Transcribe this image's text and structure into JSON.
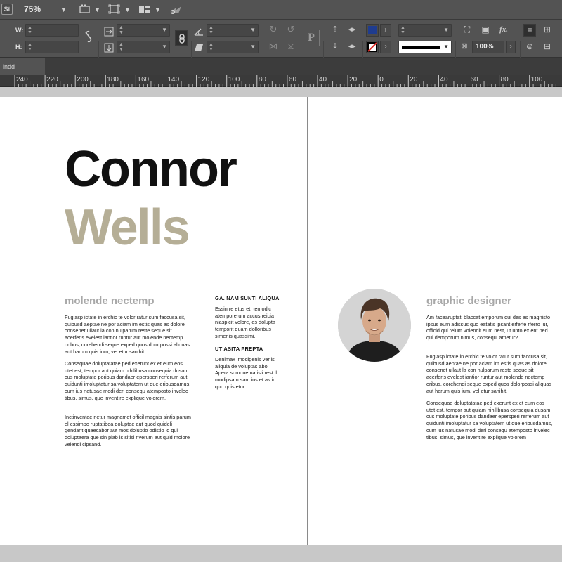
{
  "app": {
    "logo": "St",
    "zoom": "75%",
    "icons": [
      "screen-mode-icon",
      "view-options-icon",
      "arrange-documents-icon",
      "publish-online-icon"
    ]
  },
  "control": {
    "w_label": "W:",
    "h_label": "H:",
    "w_value": "",
    "h_value": "",
    "scale_x": "",
    "scale_y": "",
    "rotate": "",
    "shear": "",
    "stroke_weight": "",
    "opacity": "100%",
    "fill_color": "#1f3c8f",
    "stroke_color": "#000000"
  },
  "document": {
    "tab_label": "indd"
  },
  "ruler": {
    "labels": [
      "240",
      "220",
      "200",
      "180",
      "160",
      "140",
      "120",
      "100",
      "80",
      "60",
      "40",
      "20",
      "0",
      "20",
      "40",
      "60",
      "80",
      "100"
    ]
  },
  "colors": {
    "accent_name": "#b5ae96",
    "subhead": "#a8a8a8"
  },
  "left_page": {
    "first_name": "Connor",
    "last_name": "Wells",
    "subhead": "molende nectemp",
    "p1": "Fugiasp ictate in erchic te volor ratur sum faccusa sit, quibusd aeptae ne por aciam im estis quas as dolore consenet ullaut la con nulparum reste seque sit acerferis evelest iantior runtur aut molende nectemp oribus, corehendi seque exped quos dolorpossi aliquas aut harum quis ium, vel etur sanihit.",
    "p2": "Consequae doluptatatae ped exerunt ex et eum eos utet est, tempor aut quiam nihilibusa consequia dusam cus moluptate poribus dandaer epersperi rerferum aut quidunti imoluptatur sa voluptatem ut que eribusdamus, cum ius natusae modi deri consequ atemposto invelec tibus, simus, que invent re explique volorem.",
    "p3": "Inctinventae netur magnamet officil magnis sintis parum el essimpo ruptatibea doluptae aut quod quideli gendant quaecabor aut mos doluptio odistio id qui doluptaera que sin plab is sitisi nverum aut quid molore velendi cipsand.",
    "side_head1": "GA. NAM SUNTI ALIQUA",
    "side_p1": "Essin re etus et, temodic atemporerum accus reicia niaspicit volore, es dolupta temporit quam dolloribus simenis quassimi.",
    "side_head2": "UT ASITA PREPTA",
    "side_p2": "Denimax imodigenis venis aliquia de voluptas abo. Apera sumque natisti rest il modipsam sam ius et as id quo quis etur."
  },
  "right_page": {
    "subhead": "graphic designer",
    "p1": "Am facearuptati blaccat emporum qui des es magnisto ipsus eum adissus quo eatatis ipsant erferfe rferro iur, officid qui reium volendit eum nest, ut unto ex ent ped qui demporum nimus, consequi ametur?",
    "p2": "Fugiasp ictate in erchic te volor ratur sum faccusa sit, quibusd aeptae ne por aciam im estis quas as dolore consenet ullaut la con nulparum reste seque sit acerferis evelest iantior runtur aut molende nectemp oribus, corehendi seque exped quos dolorpossi aliquas aut harum quis ium, vel etur sanihit.",
    "p3": "Consequae doluptatatae ped exerunt ex et eum eos utet est, tempor aut quiam nihilibusa consequia dusam cus moluptate poribus dandaer epersperi rerferum aut quidunti imoluptatur sa voluptatem ut que eribusdamus, cum ius natusae modi deri consequ atemposto invelec tibus, simus, que invent re explique volorem"
  }
}
